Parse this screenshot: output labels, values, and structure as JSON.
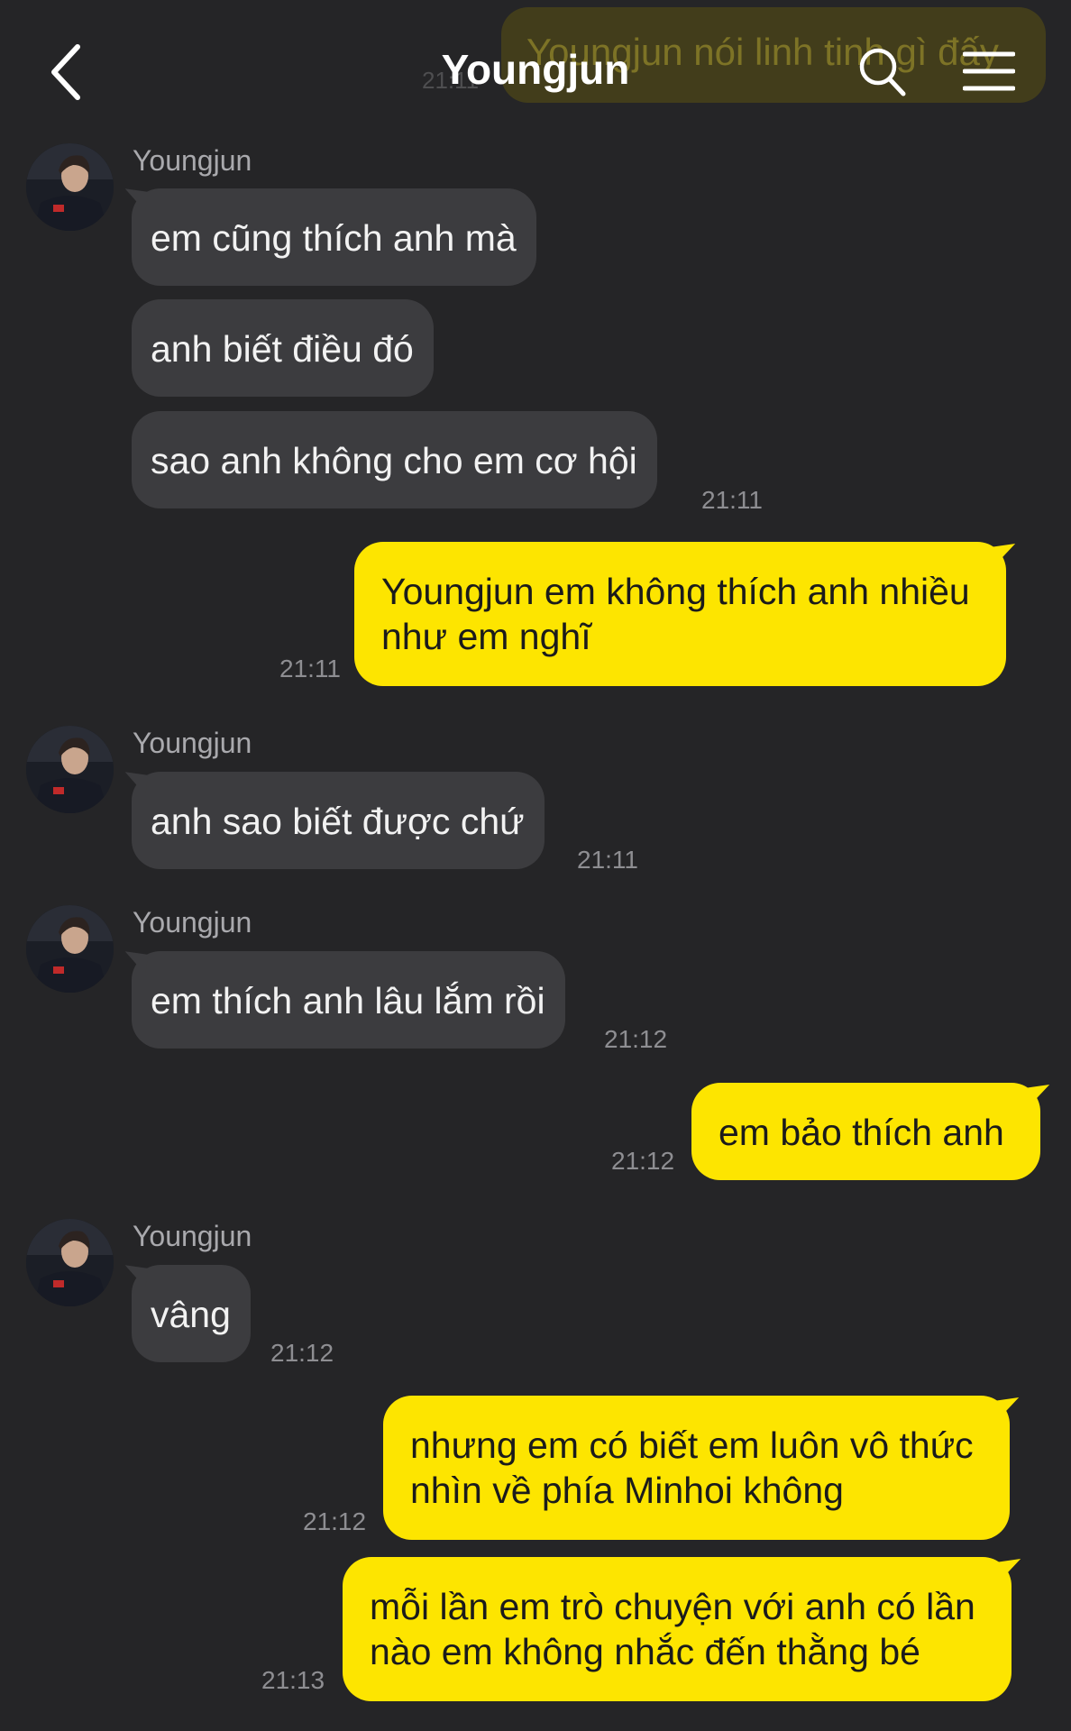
{
  "header": {
    "title": "Youngjun",
    "background_preview_text": "Youngjun nói linh tinh gì đấy",
    "background_preview_time": "21:11"
  },
  "messages": [
    {
      "sender": "Youngjun",
      "direction": "in",
      "texts": [
        "em cũng thích anh mà",
        "anh biết điều đó",
        "sao anh không cho em cơ hội"
      ],
      "time": "21:11"
    },
    {
      "direction": "out",
      "texts": [
        "Youngjun em không thích anh nhiều",
        "như em nghĩ"
      ],
      "time": "21:11"
    },
    {
      "sender": "Youngjun",
      "direction": "in",
      "texts": [
        "anh sao biết được chứ"
      ],
      "time": "21:11"
    },
    {
      "sender": "Youngjun",
      "direction": "in",
      "texts": [
        "em thích anh lâu lắm rồi"
      ],
      "time": "21:12"
    },
    {
      "direction": "out",
      "texts": [
        "em bảo thích anh"
      ],
      "time": "21:12"
    },
    {
      "sender": "Youngjun",
      "direction": "in",
      "texts": [
        "vâng"
      ],
      "time": "21:12"
    },
    {
      "direction": "out",
      "texts": [
        "nhưng em có biết em luôn vô thức",
        "nhìn về phía Minhoi không"
      ],
      "time": "21:12"
    },
    {
      "direction": "out",
      "texts": [
        "mỗi lần em trò chuyện với anh có lần",
        "nào em không nhắc đến thằng bé"
      ],
      "time": "21:13"
    }
  ],
  "icons": {
    "back": "chevron-left-icon",
    "search": "search-icon",
    "menu": "menu-icon"
  },
  "colors": {
    "background": "#252527",
    "incoming_bubble": "#3c3c3f",
    "outgoing_bubble": "#fde500"
  }
}
